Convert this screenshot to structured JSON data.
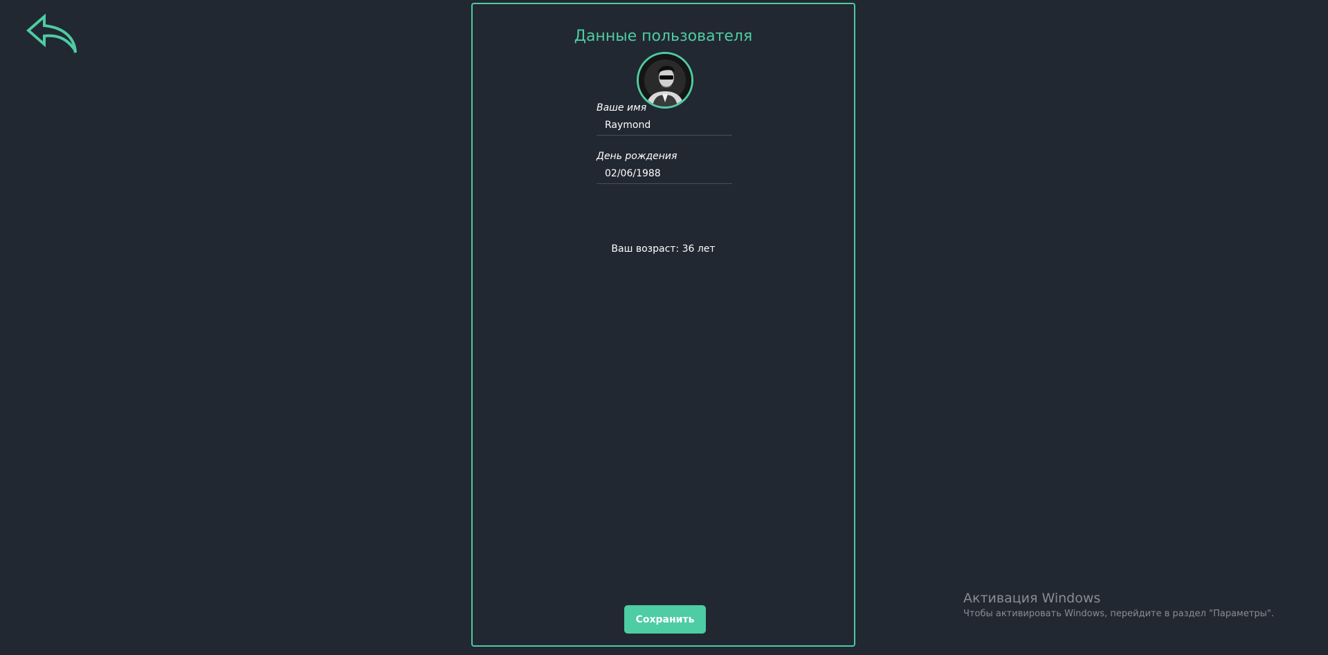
{
  "page": {
    "title": "Данные пользователя"
  },
  "form": {
    "name_label": "Ваше имя",
    "name_value": "Raymond",
    "birthday_label": "День рождения",
    "birthday_value": "02/06/1988",
    "age_text": "Ваш возраст: 36 лет",
    "save_label": "Сохранить"
  },
  "watermark": {
    "title": "Активация Windows",
    "subtitle": "Чтобы активировать Windows, перейдите в раздел \"Параметры\"."
  },
  "icons": {
    "back": "back-arrow-icon",
    "avatar": "user-avatar"
  },
  "colors": {
    "background": "#222831",
    "accent": "#4ecca3",
    "text": "#ffffff",
    "divider": "#4a4f57",
    "watermark": "#8a8d92"
  }
}
